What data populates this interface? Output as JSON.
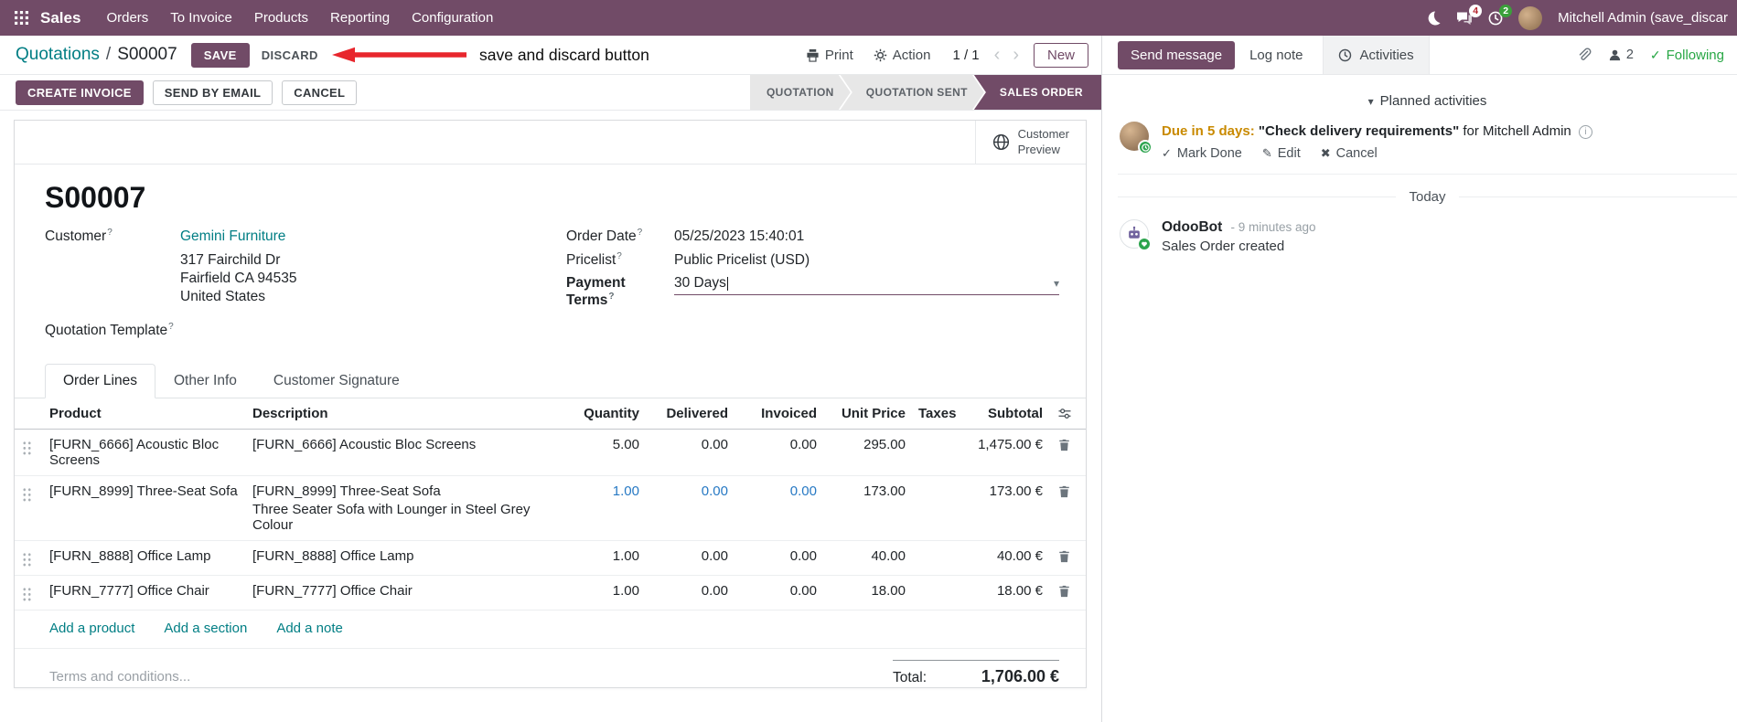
{
  "topbar": {
    "brand": "Sales",
    "menus": [
      "Orders",
      "To Invoice",
      "Products",
      "Reporting",
      "Configuration"
    ],
    "messages_badge": "4",
    "activities_badge": "2",
    "user_name": "Mitchell Admin (save_discar"
  },
  "control_panel": {
    "breadcrumb_parent": "Quotations",
    "breadcrumb_sep": "/",
    "breadcrumb_current": "S00007",
    "save_label": "SAVE",
    "discard_label": "DISCARD",
    "print_label": "Print",
    "action_label": "Action",
    "pager": "1 / 1",
    "new_label": "New"
  },
  "annotation": {
    "text": "save and discard button"
  },
  "statusbar": {
    "create_invoice": "CREATE INVOICE",
    "send_by_email": "SEND BY EMAIL",
    "cancel": "CANCEL",
    "states": [
      {
        "label": "QUOTATION",
        "active": false
      },
      {
        "label": "QUOTATION SENT",
        "active": false
      },
      {
        "label": "SALES ORDER",
        "active": true
      }
    ]
  },
  "sheet": {
    "customer_preview": {
      "line1": "Customer",
      "line2": "Preview"
    },
    "title": "S00007",
    "help_marker": "?",
    "customer": {
      "label": "Customer",
      "name": "Gemini Furniture",
      "address": [
        "317 Fairchild Dr",
        "Fairfield CA 94535",
        "United States"
      ]
    },
    "quotation_template_label": "Quotation Template",
    "order_date": {
      "label": "Order Date",
      "value": "05/25/2023 15:40:01"
    },
    "pricelist": {
      "label": "Pricelist",
      "value": "Public Pricelist (USD)"
    },
    "payment_terms": {
      "label": "Payment Terms",
      "value": "30 Days"
    },
    "tabs": [
      {
        "label": "Order Lines",
        "active": true
      },
      {
        "label": "Other Info",
        "active": false
      },
      {
        "label": "Customer Signature",
        "active": false
      }
    ],
    "order_lines": {
      "headers": {
        "product": "Product",
        "description": "Description",
        "quantity": "Quantity",
        "delivered": "Delivered",
        "invoiced": "Invoiced",
        "unit_price": "Unit Price",
        "taxes": "Taxes",
        "subtotal": "Subtotal"
      },
      "rows": [
        {
          "product": "[FURN_6666] Acoustic Bloc Screens",
          "description": "[FURN_6666] Acoustic Bloc Screens",
          "description_line2": "",
          "quantity": "5.00",
          "delivered": "0.00",
          "invoiced": "0.00",
          "unit_price": "295.00",
          "taxes": "",
          "subtotal": "1,475.00 €",
          "modified": false
        },
        {
          "product": "[FURN_8999] Three-Seat Sofa",
          "description": "[FURN_8999] Three-Seat Sofa",
          "description_line2": "Three Seater Sofa with Lounger in Steel Grey Colour",
          "quantity": "1.00",
          "delivered": "0.00",
          "invoiced": "0.00",
          "unit_price": "173.00",
          "taxes": "",
          "subtotal": "173.00 €",
          "modified": true
        },
        {
          "product": "[FURN_8888] Office Lamp",
          "description": "[FURN_8888] Office Lamp",
          "description_line2": "",
          "quantity": "1.00",
          "delivered": "0.00",
          "invoiced": "0.00",
          "unit_price": "40.00",
          "taxes": "",
          "subtotal": "40.00 €",
          "modified": false
        },
        {
          "product": "[FURN_7777] Office Chair",
          "description": "[FURN_7777] Office Chair",
          "description_line2": "",
          "quantity": "1.00",
          "delivered": "0.00",
          "invoiced": "0.00",
          "unit_price": "18.00",
          "taxes": "",
          "subtotal": "18.00 €",
          "modified": false
        }
      ],
      "footer_links": [
        "Add a product",
        "Add a section",
        "Add a note"
      ]
    },
    "terms_placeholder": "Terms and conditions...",
    "total": {
      "label": "Total:",
      "value": "1,706.00 €"
    }
  },
  "chatter": {
    "send_message": "Send message",
    "log_note": "Log note",
    "activities_tab": "Activities",
    "followers_count": "2",
    "following": "Following",
    "planned_activities_title": "Planned activities",
    "activity": {
      "due": "Due in 5 days:",
      "summary": "\"Check delivery requirements\"",
      "assignee": "for Mitchell Admin",
      "mark_done": "Mark Done",
      "edit": "Edit",
      "cancel": "Cancel"
    },
    "date_divider": "Today",
    "message": {
      "author": "OdooBot",
      "time": "- 9 minutes ago",
      "body": "Sales Order created"
    }
  },
  "colors": {
    "brand": "#714B67",
    "link": "#017e84",
    "modified_cell": "#2779c4",
    "annotation_red": "#e8262d",
    "due_warning": "#c98a00"
  }
}
